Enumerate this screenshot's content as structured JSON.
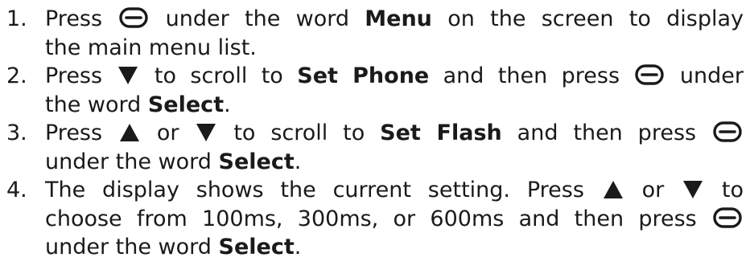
{
  "steps": [
    {
      "number": "1.",
      "lines": [
        [
          {
            "t": "Press"
          },
          {
            "icon": "softkey-icon"
          },
          {
            "t": "under the word"
          },
          {
            "b": "Menu"
          },
          {
            "t": "on the screen to display"
          }
        ],
        [
          {
            "t": "the main menu list."
          }
        ]
      ]
    },
    {
      "number": "2.",
      "lines": [
        [
          {
            "t": "Press"
          },
          {
            "icon": "down-arrow-icon"
          },
          {
            "t": "to scroll to"
          },
          {
            "b": "Set Phone"
          },
          {
            "t": "and then press"
          },
          {
            "icon": "softkey-icon"
          },
          {
            "t": "under"
          }
        ],
        [
          {
            "t": "the word"
          },
          {
            "b": "Select"
          },
          {
            "t": "."
          }
        ]
      ]
    },
    {
      "number": "3.",
      "lines": [
        [
          {
            "t": "Press"
          },
          {
            "icon": "up-arrow-icon"
          },
          {
            "t": "or"
          },
          {
            "icon": "down-arrow-icon"
          },
          {
            "t": "to scroll to"
          },
          {
            "b": "Set Flash"
          },
          {
            "t": "and then press"
          },
          {
            "icon": "softkey-icon"
          }
        ],
        [
          {
            "t": "under the word"
          },
          {
            "b": "Select"
          },
          {
            "t": "."
          }
        ]
      ]
    },
    {
      "number": "4.",
      "lines": [
        [
          {
            "t": "The display shows the current setting.  Press"
          },
          {
            "icon": "up-arrow-icon"
          },
          {
            "t": "or"
          },
          {
            "icon": "down-arrow-icon"
          },
          {
            "t": "to"
          }
        ],
        [
          {
            "t": "choose from 100ms, 300ms, or 600ms and then press"
          },
          {
            "icon": "softkey-icon"
          }
        ],
        [
          {
            "t": "under the word"
          },
          {
            "b": "Select"
          },
          {
            "t": "."
          }
        ]
      ]
    }
  ]
}
